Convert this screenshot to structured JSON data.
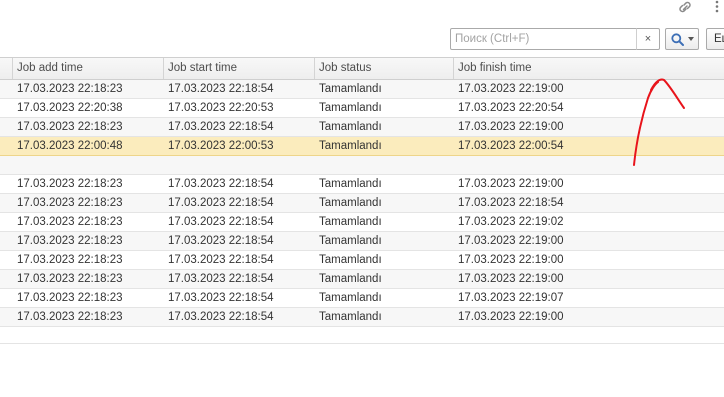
{
  "toolbar": {
    "link_icon": "link-icon",
    "more_icon": "vertical-ellipsis-icon"
  },
  "search": {
    "placeholder": "Поиск (Ctrl+F)",
    "value": "",
    "clear_label": "×",
    "find_icon": "search-icon",
    "more_button_label": "Еще"
  },
  "table": {
    "columns": [
      "Job add time",
      "Job start time",
      "Job status",
      "Job finish time"
    ],
    "rows": [
      [
        "17.03.2023 22:18:23",
        "17.03.2023 22:18:54",
        "Tamamlandı",
        "17.03.2023 22:19:00"
      ],
      [
        "17.03.2023 22:20:38",
        "17.03.2023 22:20:53",
        "Tamamlandı",
        "17.03.2023 22:20:54"
      ],
      [
        "17.03.2023 22:18:23",
        "17.03.2023 22:18:54",
        "Tamamlandı",
        "17.03.2023 22:19:00"
      ],
      [
        "17.03.2023 22:00:48",
        "17.03.2023 22:00:53",
        "Tamamlandı",
        "17.03.2023 22:00:54"
      ],
      [
        "",
        "",
        "",
        ""
      ],
      [
        "17.03.2023 22:18:23",
        "17.03.2023 22:18:54",
        "Tamamlandı",
        "17.03.2023 22:19:00"
      ],
      [
        "17.03.2023 22:18:23",
        "17.03.2023 22:18:54",
        "Tamamlandı",
        "17.03.2023 22:18:54"
      ],
      [
        "17.03.2023 22:18:23",
        "17.03.2023 22:18:54",
        "Tamamlandı",
        "17.03.2023 22:19:02"
      ],
      [
        "17.03.2023 22:18:23",
        "17.03.2023 22:18:54",
        "Tamamlandı",
        "17.03.2023 22:19:00"
      ],
      [
        "17.03.2023 22:18:23",
        "17.03.2023 22:18:54",
        "Tamamlandı",
        "17.03.2023 22:19:00"
      ],
      [
        "17.03.2023 22:18:23",
        "17.03.2023 22:18:54",
        "Tamamlandı",
        "17.03.2023 22:19:00"
      ],
      [
        "17.03.2023 22:18:23",
        "17.03.2023 22:18:54",
        "Tamamlandı",
        "17.03.2023 22:19:07"
      ],
      [
        "17.03.2023 22:18:23",
        "17.03.2023 22:18:54",
        "Tamamlandı",
        "17.03.2023 22:19:00"
      ]
    ],
    "selected_row": 3
  },
  "colors": {
    "selected_row": "#fbecbd",
    "annotation": "#e8141b",
    "accent_icon": "#3d6fb6"
  }
}
